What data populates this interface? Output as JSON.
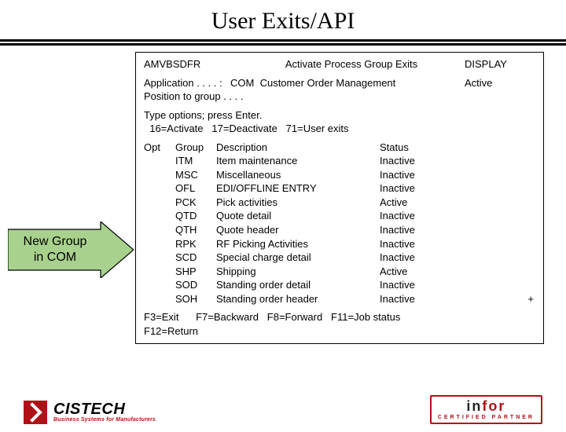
{
  "title": "User Exits/API",
  "callout": {
    "line1": "New Group",
    "line2": "in COM"
  },
  "panel": {
    "program": "AMVBSDFR",
    "heading": "Activate Process Group Exits",
    "mode": "DISPLAY",
    "app_label": "Application . . . . :",
    "app_code": "COM",
    "app_desc": "Customer Order Management",
    "app_status": "Active",
    "position_label": "Position to group . . . .",
    "options_text": "Type options; press Enter.",
    "options_line": "  16=Activate   17=Deactivate   71=User exits",
    "columns": {
      "opt": "Opt",
      "group": "Group",
      "desc": "Description",
      "status": "Status"
    },
    "rows": [
      {
        "group": "ITM",
        "desc": "Item maintenance",
        "status": "Inactive"
      },
      {
        "group": "MSC",
        "desc": "Miscellaneous",
        "status": "Inactive"
      },
      {
        "group": "OFL",
        "desc": "EDI/OFFLINE ENTRY",
        "status": "Inactive"
      },
      {
        "group": "PCK",
        "desc": "Pick activities",
        "status": "Active"
      },
      {
        "group": "QTD",
        "desc": "Quote detail",
        "status": "Inactive"
      },
      {
        "group": "QTH",
        "desc": "Quote header",
        "status": "Inactive"
      },
      {
        "group": "RPK",
        "desc": "RF Picking Activities",
        "status": "Inactive"
      },
      {
        "group": "SCD",
        "desc": "Special charge detail",
        "status": "Inactive"
      },
      {
        "group": "SHP",
        "desc": "Shipping",
        "status": "Active"
      },
      {
        "group": "SOD",
        "desc": "Standing order detail",
        "status": "Inactive"
      },
      {
        "group": "SOH",
        "desc": "Standing order header",
        "status": "Inactive"
      }
    ],
    "more_indicator": "+",
    "fnkeys_l1": "F3=Exit      F7=Backward   F8=Forward   F11=Job status",
    "fnkeys_l2": "F12=Return"
  },
  "footer": {
    "cistech_name": "CISTECH",
    "cistech_tag": "Business Systems for Manufacturers",
    "infor_brand_a": "in",
    "infor_brand_b": "for",
    "infor_sub": "CERTIFIED PARTNER"
  }
}
